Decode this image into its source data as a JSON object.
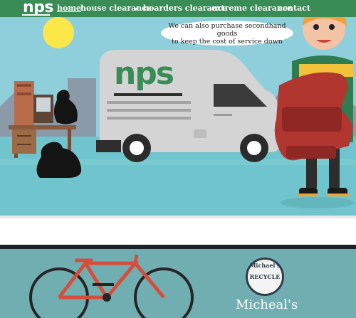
{
  "site": {
    "logo": "nps"
  },
  "nav": {
    "items": [
      {
        "label": "home"
      },
      {
        "label": "house clearance"
      },
      {
        "label": "hoarders clearance"
      },
      {
        "label": "extreme clearance"
      },
      {
        "label": "contact"
      }
    ],
    "dropdown_caret": "▾"
  },
  "hero": {
    "speech_line1": "We can also purchase secondhand goods",
    "speech_line2": "to keep the cost of service down",
    "van_logo": "nps"
  },
  "promo": {
    "badge_text": "Michael's RECYCLE",
    "title": "Micheal's"
  },
  "colors": {
    "brand_green": "#3a8c57",
    "sky": "#8ecfdb",
    "teal_band": "#71aeb1"
  }
}
